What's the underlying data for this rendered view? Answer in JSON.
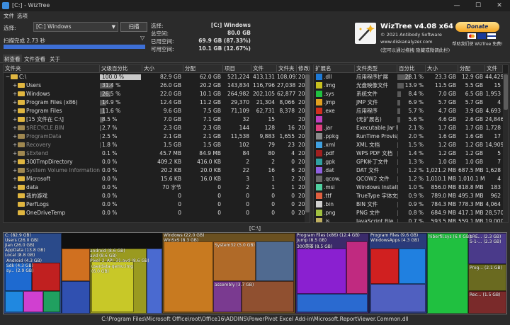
{
  "window": {
    "title": "[C:] - WizTree",
    "minimize": "—",
    "maximize": "☐",
    "close": "✕"
  },
  "menu": {
    "file": "文件",
    "options": "选项"
  },
  "top": {
    "select_label": "选择:",
    "drive": "[C:] Windows",
    "scan_button": "扫描",
    "scan_status": "扫描完成 2.73 秒",
    "progress": 1.0
  },
  "info": {
    "select_label": "选择:",
    "select_value": "[C:]  Windows",
    "total_label": "总空间:",
    "total_value": "80.0 GB",
    "used_label": "已用空间:",
    "used_value": "69.9 GB  (87.33%)",
    "free_label": "可用空间:",
    "free_value": "10.1 GB  (12.67%)"
  },
  "about": {
    "product": "WizTree v4.08 x64",
    "copyright": "© 2021 Antibody Software",
    "website": "www.diskanalyzer.com",
    "tagline": "(您可以通过拖拽  隐藏或微调此栏)",
    "donate": "Donate",
    "donate_caption": "帮助我们使 WizTree 免费!"
  },
  "tabs": [
    "树查看",
    "文件查看",
    "关于"
  ],
  "tree": {
    "headers": [
      "文件夹",
      "父级百分比",
      "大小",
      "分配",
      "项目",
      "文件",
      "文件夹",
      "修改时间"
    ],
    "rows": [
      {
        "name": "C:\\",
        "pct": "100.0 %",
        "p": 100,
        "size": "82.9 GB",
        "alloc": "62.0 GB",
        "items": "521,224",
        "files": "413,131",
        "folders": "108,093",
        "mod": "2022/4/21 1",
        "lvl": 0,
        "exp": "−",
        "gray": false,
        "sel": true
      },
      {
        "name": "Users",
        "pct": "31.4 %",
        "p": 31.4,
        "size": "26.0 GB",
        "alloc": "20.2 GB",
        "items": "143,834",
        "files": "116,796",
        "folders": "27,038",
        "mod": "2022/4/21 1",
        "lvl": 1,
        "exp": "+",
        "gray": false
      },
      {
        "name": "Windows",
        "pct": "26.5 %",
        "p": 26.5,
        "size": "22.0 GB",
        "alloc": "10.1 GB",
        "items": "264,982",
        "files": "202,105",
        "folders": "62,877",
        "mod": "2022/4/21 1",
        "lvl": 1,
        "exp": "+",
        "gray": false
      },
      {
        "name": "Program Files (x86)",
        "pct": "14.9 %",
        "p": 14.9,
        "size": "12.4 GB",
        "alloc": "11.2 GB",
        "items": "29,370",
        "files": "21,304",
        "folders": "8,066",
        "mod": "2022/3/9 21",
        "lvl": 1,
        "exp": "+",
        "gray": false
      },
      {
        "name": "Program Files",
        "pct": "11.6 %",
        "p": 11.6,
        "size": "9.6 GB",
        "alloc": "7.5 GB",
        "items": "71,109",
        "files": "62,731",
        "folders": "8,378",
        "mod": "2022/4/21 1",
        "lvl": 1,
        "exp": "+",
        "gray": false
      },
      {
        "name": "[15 文件在 C:\\]",
        "pct": "8.5 %",
        "p": 8.5,
        "size": "7.0 GB",
        "alloc": "7.1 GB",
        "items": "32",
        "files": "15",
        "folders": "",
        "mod": "2022/4/21 1",
        "lvl": 1,
        "exp": "+",
        "gray": false
      },
      {
        "name": "$RECYCLE.BIN",
        "pct": "2.7 %",
        "p": 2.7,
        "size": "2.3 GB",
        "alloc": "2.3 GB",
        "items": "144",
        "files": "128",
        "folders": "16",
        "mod": "2022/3/10 2",
        "lvl": 1,
        "exp": "+",
        "gray": true
      },
      {
        "name": "ProgramData",
        "pct": "2.5 %",
        "p": 2.5,
        "size": "2.1 GB",
        "alloc": "2.1 GB",
        "items": "11,538",
        "files": "9,883",
        "folders": "1,655",
        "mod": "2022/4/21 1",
        "lvl": 1,
        "exp": "+",
        "gray": true
      },
      {
        "name": "Recovery",
        "pct": "1.8 %",
        "p": 1.8,
        "size": "1.5 GB",
        "alloc": "1.5 GB",
        "items": "102",
        "files": "79",
        "folders": "23",
        "mod": "2021/11/3 1",
        "lvl": 1,
        "exp": "+",
        "gray": true
      },
      {
        "name": "$Extend",
        "pct": "0.1 %",
        "p": 0.1,
        "size": "45.7 MB",
        "alloc": "84.9 MB",
        "items": "84",
        "files": "80",
        "folders": "4",
        "mod": "2020/8/13 1",
        "lvl": 1,
        "exp": "+",
        "gray": true
      },
      {
        "name": "300TmpDirectory",
        "pct": "0.0 %",
        "p": 0,
        "size": "409.2 KB",
        "alloc": "416.0 KB",
        "items": "2",
        "files": "2",
        "folders": "0",
        "mod": "2022/1/6 21",
        "lvl": 1,
        "exp": "+",
        "gray": false
      },
      {
        "name": "System Volume Information",
        "pct": "0.0 %",
        "p": 0,
        "size": "20.2 KB",
        "alloc": "20.0 KB",
        "items": "22",
        "files": "16",
        "folders": "6",
        "mod": "2022/2/22 1",
        "lvl": 1,
        "exp": "+",
        "gray": true
      },
      {
        "name": "Microsoft",
        "pct": "0.0 %",
        "p": 0,
        "size": "15.6 KB",
        "alloc": "16.0 KB",
        "items": "3",
        "files": "1",
        "folders": "2",
        "mod": "2020/8/13 1",
        "lvl": 1,
        "exp": "+",
        "gray": false
      },
      {
        "name": "data",
        "pct": "0.0 %",
        "p": 0,
        "size": "70 字节",
        "alloc": "0",
        "items": "2",
        "files": "1",
        "folders": "1",
        "mod": "2020/10/17",
        "lvl": 1,
        "exp": "+",
        "gray": false
      },
      {
        "name": "我的游戏",
        "pct": "0.0 %",
        "p": 0,
        "size": "0",
        "alloc": "0",
        "items": "0",
        "files": "0",
        "folders": "0",
        "mod": "2021/11/4 1",
        "lvl": 1,
        "exp": "",
        "gray": false
      },
      {
        "name": "PerfLogs",
        "pct": "0.0 %",
        "p": 0,
        "size": "0",
        "alloc": "0",
        "items": "0",
        "files": "0",
        "folders": "0",
        "mod": "2021/6/5 20",
        "lvl": 1,
        "exp": "",
        "gray": false
      },
      {
        "name": "OneDriveTemp",
        "pct": "0.0 %",
        "p": 0,
        "size": "0",
        "alloc": "0",
        "items": "0",
        "files": "0",
        "folders": "0",
        "mod": "2020/8/13 1",
        "lvl": 1,
        "exp": "",
        "gray": false
      }
    ]
  },
  "ext": {
    "headers": [
      "扩展名",
      "文件类型",
      "百分比",
      "大小",
      "分配",
      "文件"
    ],
    "rows": [
      {
        "ext": ".dll",
        "type": "应用程序扩展",
        "pct": "28.1 %",
        "size": "23.3 GB",
        "alloc": "12.9 GB",
        "files": "44,429",
        "color": "#1e7ad6"
      },
      {
        "ext": ".img",
        "type": "光盘映像文件",
        "pct": "13.9 %",
        "size": "11.5 GB",
        "alloc": "5.5 GB",
        "files": "15",
        "color": "#c8c020"
      },
      {
        "ext": ".sys",
        "type": "系统文件",
        "pct": "8.4 %",
        "size": "7.0 GB",
        "alloc": "6.5 GB",
        "files": "1,953",
        "color": "#20c040"
      },
      {
        "ext": ".jmp",
        "type": "JMP 文件",
        "pct": "6.9 %",
        "size": "5.7 GB",
        "alloc": "5.7 GB",
        "files": "4",
        "color": "#e0a020"
      },
      {
        "ext": ".exe",
        "type": "应用程序",
        "pct": "5.7 %",
        "size": "4.7 GB",
        "alloc": "3.9 GB",
        "files": "4,693",
        "color": "#d03020"
      },
      {
        "ext": "",
        "type": "(无扩展名)",
        "pct": "5.6 %",
        "size": "4.6 GB",
        "alloc": "2.6 GB",
        "files": "24,846",
        "color": "#c040c0"
      },
      {
        "ext": ".jar",
        "type": "Executable Jar F",
        "pct": "2.1 %",
        "size": "1.7 GB",
        "alloc": "1.7 GB",
        "files": "1,728",
        "color": "#e04080"
      },
      {
        "ext": ".ppkg",
        "type": "RunTime Provisi",
        "pct": "2.0 %",
        "size": "1.6 GB",
        "alloc": "1.6 GB",
        "files": "17",
        "color": "#8a8a8a"
      },
      {
        "ext": ".xml",
        "type": "XML 文档",
        "pct": "1.5 %",
        "size": "1.2 GB",
        "alloc": "1.2 GB",
        "files": "14,909",
        "color": "#40a0e0"
      },
      {
        "ext": ".pdf",
        "type": "WPS PDF 文档",
        "pct": "1.4 %",
        "size": "1.2 GB",
        "alloc": "1.2 GB",
        "files": "5",
        "color": "#a02020"
      },
      {
        "ext": ".gpk",
        "type": "GPK补丁文件",
        "pct": "1.3 %",
        "size": "1.0 GB",
        "alloc": "1.0 GB",
        "files": "7",
        "color": "#30a0a0"
      },
      {
        "ext": ".dat",
        "type": "DAT 文件",
        "pct": "1.2 %",
        "size": "1,021.2 MB",
        "alloc": "687.5 MB",
        "files": "1,628",
        "color": "#9060e0"
      },
      {
        "ext": ".qcow.",
        "type": "QCOW2 文件",
        "pct": "1.2 %",
        "size": "1,010.1 MB",
        "alloc": "1,010.1 MB",
        "files": "4",
        "color": "#6a6a6a"
      },
      {
        "ext": ".msi",
        "type": "Windows Installe",
        "pct": "1.0 %",
        "size": "856.0 MB",
        "alloc": "818.8 MB",
        "files": "183",
        "color": "#50d0a0"
      },
      {
        "ext": ".ttf",
        "type": "TrueType 字体文",
        "pct": "0.9 %",
        "size": "789.0 MB",
        "alloc": "495.3 MB",
        "files": "962",
        "color": "#e06040"
      },
      {
        "ext": ".bin",
        "type": "BIN 文件",
        "pct": "0.9 %",
        "size": "784.3 MB",
        "alloc": "778.3 MB",
        "files": "4,064",
        "color": "#d0d0d0"
      },
      {
        "ext": ".png",
        "type": "PNG 文件",
        "pct": "0.8 %",
        "size": "684.9 MB",
        "alloc": "417.1 MB",
        "files": "28,570",
        "color": "#a0c040"
      },
      {
        "ext": ".js",
        "type": "JavaScript File",
        "pct": "0.7 %",
        "size": "593.5 MB",
        "alloc": "559.1 MB",
        "files": "19,000",
        "color": "#c0b060"
      }
    ]
  },
  "treemap": {
    "current": "[C:\\]",
    "labels": {
      "root": "C: (82.9 GB)",
      "users": "Users (26.0 GB)",
      "jian": "Jian (26.0 GB)",
      "appdata": "AppData (13.8 GB)",
      "local": "Local (8.8 GB)",
      "android": "Android (4.3 GB)",
      "sdk": "Sdk (4.3 GB)",
      "sy": "sy... (2.9 GB)",
      "android2": "android (8.6 GB)",
      "avd": "avd (8.6 GB)",
      "pixel": "Pixel_2_API_31.avd (8.6 GB)",
      "userdata": "userdata-qemu.img",
      "userdata_size": "(6.0 GB)",
      "windows": "Windows (22.0 GB)",
      "winsxs": "WinSxS (8.3 GB)",
      "system32": "System32 (5.0 GB)",
      "assembly": "assembly (3.7 GB)",
      "pf86": "Program Files (x86) (12.4 GB)",
      "jump": "Jump (8.5 GB)",
      "jump300": "300英雄 (8.5 GB)",
      "pf": "Program Files (9.6 GB)",
      "windowsapps": "WindowsApps (4.3 GB)",
      "hiberfil": "hiberfil.sys (6.0 GB)",
      "recycle": "$RE... (2.3 GB)",
      "s1": "S-1-... (2.3 GB)",
      "prog": "Prog... (2.1 GB)",
      "rec": "Rec... (1.5 GB)"
    }
  },
  "status": {
    "path": "C:\\Program Files\\Microsoft Office\\root\\Office16\\ADDINS\\PowerPivot Excel Add-in\\Microsoft.ReportViewer.Common.dll"
  },
  "colors": {
    "background": "#2b2b2b",
    "pane": "#1f1f1f",
    "accent": "#3d6fd6",
    "folder": "#e0b640"
  }
}
